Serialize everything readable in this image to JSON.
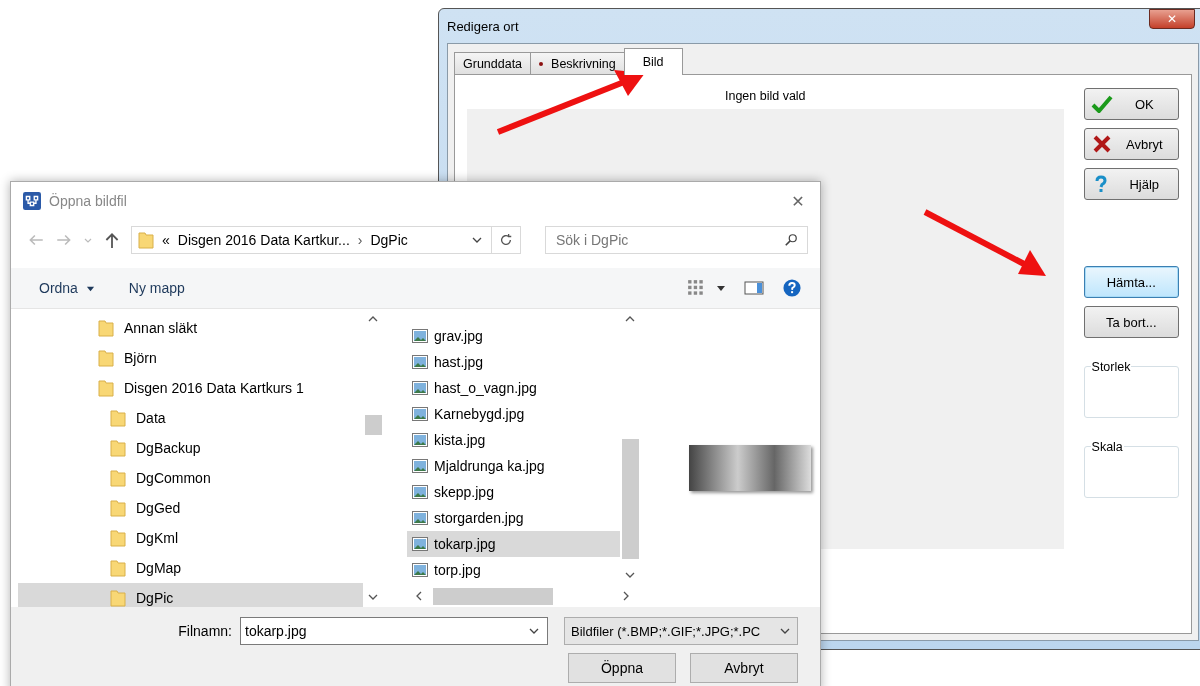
{
  "edit_window": {
    "title": "Redigera ort",
    "close": "✕",
    "tabs": [
      {
        "label": "Grunddata",
        "selected": false,
        "marked": false
      },
      {
        "label": "Beskrivning",
        "selected": false,
        "marked": true
      },
      {
        "label": "Bild",
        "selected": true,
        "marked": false
      }
    ],
    "image_caption": "Ingen bild vald",
    "buttons": [
      {
        "label": "OK",
        "kind": "ok",
        "focused": false
      },
      {
        "label": "Avbryt",
        "kind": "cancel",
        "focused": false
      },
      {
        "label": "Hjälp",
        "kind": "help",
        "focused": false
      },
      {
        "label": "Hämta...",
        "kind": "plain",
        "focused": true
      },
      {
        "label": "Ta bort...",
        "kind": "plain",
        "focused": false
      }
    ],
    "groups": [
      "Storlek",
      "Skala"
    ]
  },
  "open_dialog": {
    "title": "Öppna bildfil",
    "close": "✕",
    "address": {
      "chevron": "«",
      "path": [
        "Disgen 2016 Data Kartkur...",
        "DgPic"
      ],
      "separator": "›"
    },
    "search": {
      "placeholder": "Sök i DgPic"
    },
    "toolbar": {
      "organize": "Ordna",
      "new_folder": "Ny mapp"
    },
    "folders": [
      {
        "label": "Annan släkt",
        "selected": false
      },
      {
        "label": "Björn",
        "selected": false
      },
      {
        "label": "Disgen 2016 Data Kartkurs 1",
        "selected": false,
        "children": [
          {
            "label": "Data",
            "selected": false
          },
          {
            "label": "DgBackup",
            "selected": false
          },
          {
            "label": "DgCommon",
            "selected": false
          },
          {
            "label": "DgGed",
            "selected": false
          },
          {
            "label": "DgKml",
            "selected": false
          },
          {
            "label": "DgMap",
            "selected": false
          },
          {
            "label": "DgPic",
            "selected": true
          }
        ]
      }
    ],
    "files": [
      {
        "name": "grav.jpg",
        "selected": false
      },
      {
        "name": "hast.jpg",
        "selected": false
      },
      {
        "name": "hast_o_vagn.jpg",
        "selected": false
      },
      {
        "name": "Karnebygd.jpg",
        "selected": false
      },
      {
        "name": "kista.jpg",
        "selected": false
      },
      {
        "name": "Mjaldrunga ka.jpg",
        "selected": false
      },
      {
        "name": "skepp.jpg",
        "selected": false
      },
      {
        "name": "storgarden.jpg",
        "selected": false
      },
      {
        "name": "tokarp.jpg",
        "selected": true
      },
      {
        "name": "torp.jpg",
        "selected": false
      }
    ],
    "filename_label": "Filnamn:",
    "filename": "tokarp.jpg",
    "filter": "Bildfiler (*.BMP;*.GIF;*.JPG;*.PC",
    "buttons": [
      "Öppna",
      "Avbryt"
    ]
  }
}
